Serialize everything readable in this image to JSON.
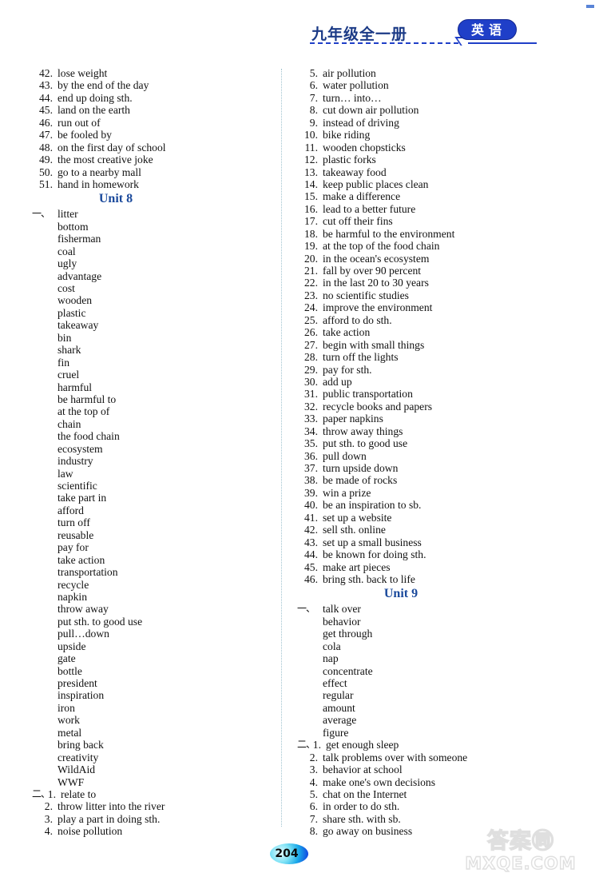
{
  "header": {
    "title": "九年级全一册",
    "badge": "英语",
    "accent_color": "#1f3fc8"
  },
  "footer": {
    "page_number": "204",
    "watermark_cn": "答案㉄",
    "watermark_en": "MXQE.COM"
  },
  "left_column": {
    "continued_numbered": [
      {
        "num": "42.",
        "text": "lose weight"
      },
      {
        "num": "43.",
        "text": "by the end of the day"
      },
      {
        "num": "44.",
        "text": "end up doing sth."
      },
      {
        "num": "45.",
        "text": "land on the earth"
      },
      {
        "num": "46.",
        "text": "run out of"
      },
      {
        "num": "47.",
        "text": "be fooled by"
      },
      {
        "num": "48.",
        "text": "on the first day of school"
      },
      {
        "num": "49.",
        "text": "the most creative joke"
      },
      {
        "num": "50.",
        "text": "go to a nearby mall"
      },
      {
        "num": "51.",
        "text": "hand in homework"
      }
    ],
    "unit_heading": "Unit 8",
    "section_one_marker": "一、",
    "words": [
      "litter",
      "bottom",
      "fisherman",
      "coal",
      "ugly",
      "advantage",
      "cost",
      "wooden",
      "plastic",
      "takeaway",
      "bin",
      "shark",
      "fin",
      "cruel",
      "harmful",
      "be harmful to",
      "at the top of",
      "chain",
      "the food chain",
      "ecosystem",
      "industry",
      "law",
      "scientific",
      "take part in",
      "afford",
      "turn off",
      "reusable",
      "pay for",
      "take action",
      "transportation",
      "recycle",
      "napkin",
      "throw away",
      "put sth. to good use",
      "pull…down",
      "upside",
      "gate",
      "bottle",
      "president",
      "inspiration",
      "iron",
      "work",
      "metal",
      "bring back",
      "creativity",
      "WildAid",
      "WWF"
    ],
    "section_two_marker": "二、",
    "phrases": [
      {
        "num": "1.",
        "text": "relate to"
      },
      {
        "num": "2.",
        "text": "throw litter into the river"
      },
      {
        "num": "3.",
        "text": "play a part in doing sth."
      },
      {
        "num": "4.",
        "text": "noise pollution"
      }
    ]
  },
  "right_column": {
    "phrases_continued": [
      {
        "num": "5.",
        "text": "air pollution"
      },
      {
        "num": "6.",
        "text": "water pollution"
      },
      {
        "num": "7.",
        "text": "turn… into…"
      },
      {
        "num": "8.",
        "text": "cut down air pollution"
      },
      {
        "num": "9.",
        "text": "instead of driving"
      },
      {
        "num": "10.",
        "text": "bike riding"
      },
      {
        "num": "11.",
        "text": "wooden chopsticks"
      },
      {
        "num": "12.",
        "text": "plastic forks"
      },
      {
        "num": "13.",
        "text": "takeaway food"
      },
      {
        "num": "14.",
        "text": "keep public places clean"
      },
      {
        "num": "15.",
        "text": "make a difference"
      },
      {
        "num": "16.",
        "text": "lead to a better future"
      },
      {
        "num": "17.",
        "text": "cut off their fins"
      },
      {
        "num": "18.",
        "text": "be harmful to the environment"
      },
      {
        "num": "19.",
        "text": "at the top of the food chain"
      },
      {
        "num": "20.",
        "text": "in the ocean's ecosystem"
      },
      {
        "num": "21.",
        "text": "fall by over 90 percent"
      },
      {
        "num": "22.",
        "text": "in the last 20 to 30 years"
      },
      {
        "num": "23.",
        "text": "no scientific studies"
      },
      {
        "num": "24.",
        "text": "improve the environment"
      },
      {
        "num": "25.",
        "text": "afford to do sth."
      },
      {
        "num": "26.",
        "text": "take action"
      },
      {
        "num": "27.",
        "text": "begin with small things"
      },
      {
        "num": "28.",
        "text": "turn off the lights"
      },
      {
        "num": "29.",
        "text": "pay for sth."
      },
      {
        "num": "30.",
        "text": "add up"
      },
      {
        "num": "31.",
        "text": "public transportation"
      },
      {
        "num": "32.",
        "text": "recycle books and papers"
      },
      {
        "num": "33.",
        "text": "paper napkins"
      },
      {
        "num": "34.",
        "text": "throw away things"
      },
      {
        "num": "35.",
        "text": "put sth. to good use"
      },
      {
        "num": "36.",
        "text": "pull down"
      },
      {
        "num": "37.",
        "text": "turn upside down"
      },
      {
        "num": "38.",
        "text": "be made of rocks"
      },
      {
        "num": "39.",
        "text": "win a prize"
      },
      {
        "num": "40.",
        "text": "be an inspiration to sb."
      },
      {
        "num": "41.",
        "text": "set up a website"
      },
      {
        "num": "42.",
        "text": "sell sth. online"
      },
      {
        "num": "43.",
        "text": "set up a small business"
      },
      {
        "num": "44.",
        "text": "be known for doing sth."
      },
      {
        "num": "45.",
        "text": "make art pieces"
      },
      {
        "num": "46.",
        "text": "bring sth. back to life"
      }
    ],
    "unit_heading": "Unit 9",
    "section_one_marker": "一、",
    "words": [
      "talk over",
      "behavior",
      "get through",
      "cola",
      "nap",
      "concentrate",
      "effect",
      "regular",
      "amount",
      "average",
      "figure"
    ],
    "section_two_marker": "二、",
    "phrases": [
      {
        "num": "1.",
        "text": "get enough sleep"
      },
      {
        "num": "2.",
        "text": "talk problems over with someone"
      },
      {
        "num": "3.",
        "text": "behavior at school"
      },
      {
        "num": "4.",
        "text": "make one's own decisions"
      },
      {
        "num": "5.",
        "text": "chat on the Internet"
      },
      {
        "num": "6.",
        "text": "in order to do sth."
      },
      {
        "num": "7.",
        "text": "share sth. with sb."
      },
      {
        "num": "8.",
        "text": "go away on business"
      }
    ]
  }
}
